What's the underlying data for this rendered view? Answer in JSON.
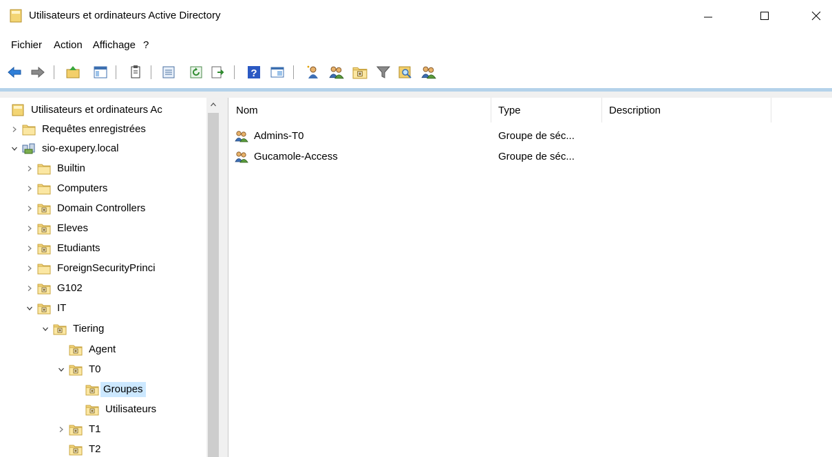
{
  "window": {
    "title": "Utilisateurs et ordinateurs Active Directory",
    "controls": [
      "minimize-icon",
      "maximize-icon",
      "close-icon"
    ]
  },
  "menubar": {
    "items": [
      "Fichier",
      "Action",
      "Affichage",
      "?"
    ]
  },
  "toolbar": {
    "buttons": [
      "back-icon",
      "forward-icon",
      "up-folder-icon",
      "show-tree-icon",
      "copy-icon",
      "properties-icon",
      "refresh-icon",
      "export-icon",
      "help-icon",
      "console-icon",
      "new-user-icon",
      "new-group-icon",
      "new-ou-icon",
      "filter-icon",
      "find-icon",
      "add-to-group-icon"
    ]
  },
  "tree": {
    "root": "Utilisateurs et ordinateurs Ac",
    "saved_queries": "Requêtes enregistrées",
    "domain": "sio-exupery.local",
    "builtin": "Builtin",
    "computers": "Computers",
    "domain_controllers": "Domain Controllers",
    "eleves": "Eleves",
    "etudiants": "Etudiants",
    "fsp": "ForeignSecurityPrinci",
    "g102": "G102",
    "it": "IT",
    "tiering": "Tiering",
    "agent": "Agent",
    "t0": "T0",
    "groupes": "Groupes",
    "utilisateurs": "Utilisateurs",
    "t1": "T1",
    "t2": "T2"
  },
  "list": {
    "columns": {
      "name": "Nom",
      "type": "Type",
      "description": "Description"
    },
    "rows": [
      {
        "name": "Admins-T0",
        "type": "Groupe de séc...",
        "description": ""
      },
      {
        "name": "Gucamole-Access",
        "type": "Groupe de séc...",
        "description": ""
      }
    ]
  },
  "colors": {
    "selection": "#cce8ff",
    "accent_band": "#b4d2ea"
  }
}
